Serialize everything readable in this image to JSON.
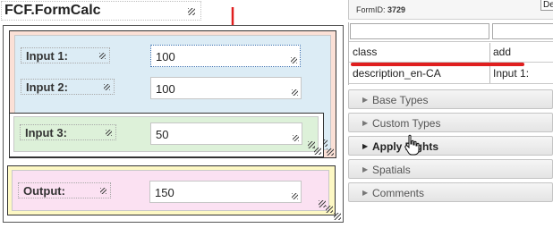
{
  "form": {
    "title": "FCF.FormCalc",
    "inputs": [
      {
        "label": "Input 1:",
        "value": "100"
      },
      {
        "label": "Input 2:",
        "value": "100"
      },
      {
        "label": "Input 3:",
        "value": "50"
      }
    ],
    "output": {
      "label": "Output:",
      "value": "150"
    }
  },
  "properties": {
    "form_id_label": "FormID:",
    "form_id_value": "3729",
    "top_button": "De",
    "rows": [
      {
        "key": "class",
        "value": "add"
      },
      {
        "key": "description_en-CA",
        "value": "Input 1:"
      }
    ]
  },
  "accordion": [
    {
      "label": "Base Types",
      "active": false
    },
    {
      "label": "Custom Types",
      "active": false
    },
    {
      "label": "Apply Rights",
      "active": true
    },
    {
      "label": "Spatials",
      "active": false
    },
    {
      "label": "Comments",
      "active": false
    }
  ],
  "colors": {
    "annotation_red": "#e01f1f",
    "section1_bg": "#fbe0d6",
    "section1_inner": "#dcecf5",
    "section2_inner": "#ddf1d9",
    "section3_bg": "#fdf8c4",
    "section3_inner": "#fbe1f2"
  }
}
